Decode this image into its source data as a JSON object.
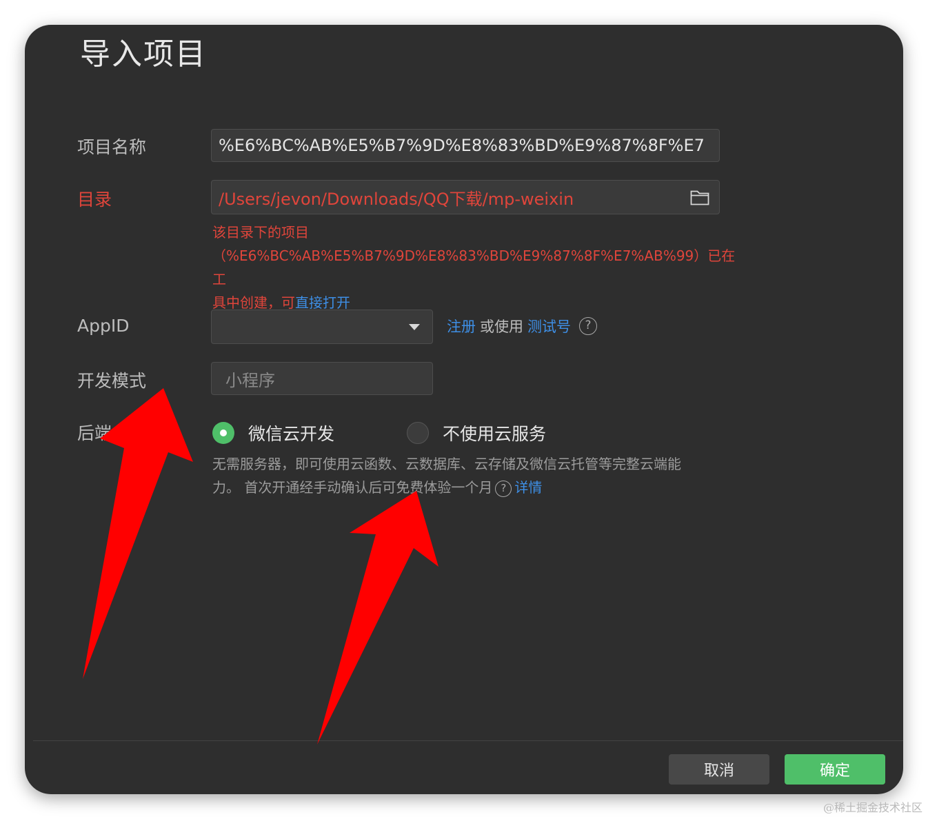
{
  "dialog": {
    "title": "导入项目",
    "project_name": {
      "label": "项目名称",
      "value": "%E6%BC%AB%E5%B7%9D%E8%83%BD%E9%87%8F%E7"
    },
    "directory": {
      "label": "目录",
      "value": "/Users/jevon/Downloads/QQ下载/mp-weixin",
      "icon": "folder-icon",
      "error_line1": "该目录下的项目",
      "error_line2": "（%E6%BC%AB%E5%B7%9D%E8%83%BD%E9%87%8F%E7%AB%99）已在工",
      "error_line3_prefix": "具中创建，可",
      "error_link": "直接打开"
    },
    "appid": {
      "label": "AppID",
      "value": "",
      "register_link": "注册",
      "or_use_text": "或使用",
      "test_link": "测试号",
      "help_icon": "question-circle-icon"
    },
    "dev_mode": {
      "label": "开发模式",
      "value": "小程序"
    },
    "backend": {
      "label": "后端",
      "options": [
        {
          "label": "微信云开发",
          "selected": true
        },
        {
          "label": "不使用云服务",
          "selected": false
        }
      ],
      "desc_line1": "无需服务器，即可使用云函数、云数据库、云存储及微信云托管等完整云端能",
      "desc_line2": "力。 首次开通经手动确认后可免费体验一个月",
      "details_link": "详情"
    },
    "buttons": {
      "cancel": "取消",
      "confirm": "确定"
    }
  },
  "colors": {
    "background": "#2e2e2e",
    "error": "#e0453b",
    "link": "#3e8fe6",
    "primary": "#4fbf69",
    "annotation_arrow": "#ff0000"
  },
  "watermark": "@稀土掘金技术社区"
}
